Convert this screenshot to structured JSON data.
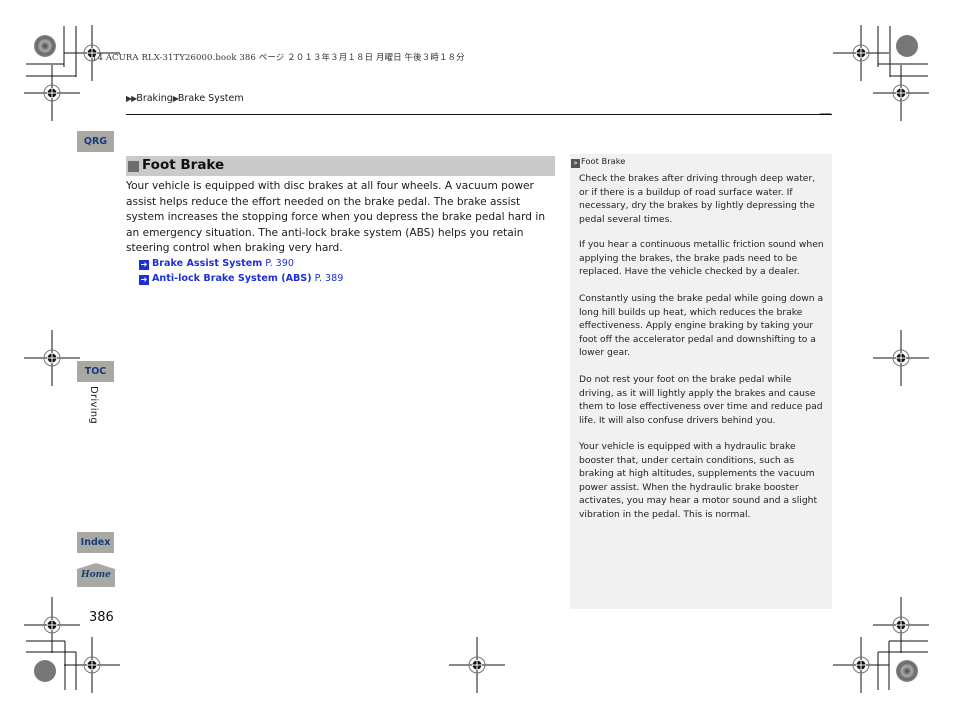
{
  "print_header": {
    "text": "14 ACURA RLX-31TY26000.book  386 ページ  ２０１３年３月１８日  月曜日  午後３時１８分"
  },
  "breadcrumb": {
    "items": [
      "Braking",
      "Brake System"
    ]
  },
  "side_nav": {
    "qrg_label": "QRG",
    "toc_label": "TOC",
    "section_label": "Driving",
    "index_label": "Index",
    "home_label": "Home"
  },
  "page_number": "386",
  "main": {
    "section_title": "Foot Brake",
    "body": "Your vehicle is equipped with disc brakes at all four wheels. A vacuum power assist helps reduce the effort needed on the brake pedal. The brake assist system increases the stopping force when you depress the brake pedal hard in an emergency situation. The anti-lock brake system (ABS) helps you retain steering control when braking very hard.",
    "cross_refs": [
      {
        "label": "Brake Assist System",
        "page": "P. 390"
      },
      {
        "label": "Anti-lock Brake System (ABS)",
        "page": "P. 389"
      }
    ]
  },
  "note": {
    "title": "Foot Brake",
    "paragraphs": [
      "Check the brakes after driving through deep water, or if there is a buildup of road surface water. If necessary, dry the brakes by lightly depressing the pedal several times.",
      "If you hear a continuous metallic friction sound when applying the brakes, the brake pads need to be replaced. Have the vehicle checked by a dealer.",
      "Constantly using the brake pedal while going down a long hill builds up heat, which reduces the brake effectiveness. Apply engine braking by taking your foot off the accelerator pedal and downshifting to a lower gear.",
      "Do not rest your foot on the brake pedal while driving, as it will lightly apply the brakes and cause them to lose effectiveness over time and reduce pad life. It will also confuse drivers behind you.",
      "Your vehicle is equipped with a hydraulic brake booster that, under certain conditions, such as braking at high altitudes, supplements the vacuum power assist. When the hydraulic brake booster activates, you may hear a motor sound and a slight vibration in the pedal. This is normal."
    ]
  },
  "colors": {
    "link": "#1e2fd8",
    "tab_bg": "#a9a9a3",
    "tab_text": "#1b3a7a",
    "header_bar": "#cacaca",
    "note_bg": "#f1f1f1"
  }
}
